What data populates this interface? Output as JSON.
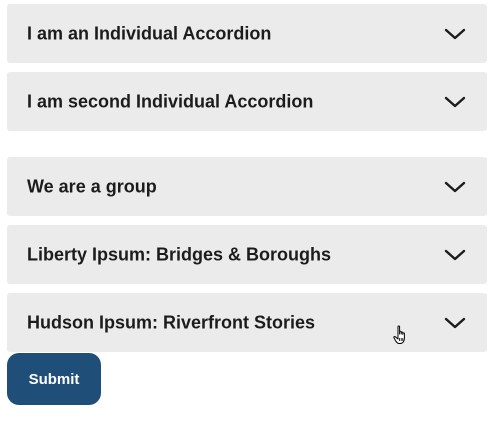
{
  "accordions": [
    {
      "title": "I am an Individual Accordion",
      "expanded": false,
      "icon": "chevron-down-icon"
    },
    {
      "title": "I am second Individual Accordion",
      "expanded": false,
      "icon": "chevron-down-icon"
    },
    {
      "title": "We are a group",
      "expanded": false,
      "icon": "chevron-down-icon"
    },
    {
      "title": "Liberty Ipsum: Bridges & Boroughs",
      "expanded": false,
      "icon": "chevron-down-icon"
    },
    {
      "title": "Hudson Ipsum: Riverfront Stories",
      "expanded": false,
      "icon": "chevron-down-icon"
    }
  ],
  "form": {
    "submit_label": "Submit"
  },
  "colors": {
    "accordion_bg": "#ebebeb",
    "text": "#1c1c1c",
    "button_bg": "#1f4e79",
    "button_text": "#ffffff"
  }
}
